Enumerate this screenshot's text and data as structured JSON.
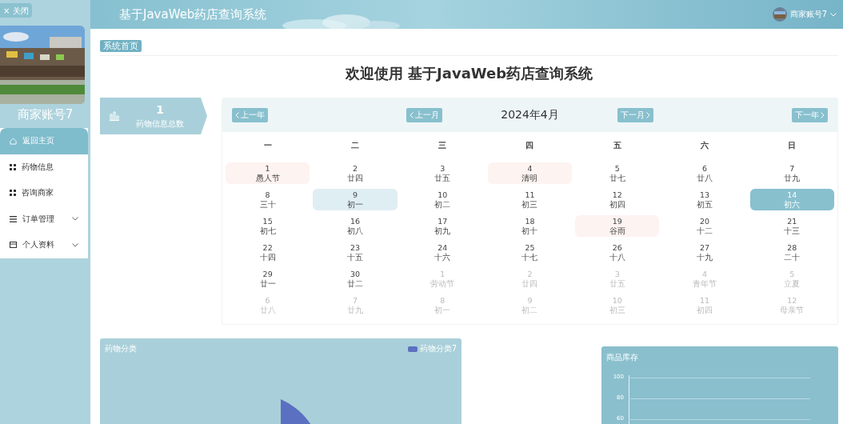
{
  "sidebar": {
    "close_button": "× 关闭",
    "user_name": "商家账号7",
    "menu": [
      {
        "label": "返回主页",
        "selected": true,
        "expandable": false
      },
      {
        "label": "药物信息",
        "selected": false,
        "expandable": false
      },
      {
        "label": "咨询商家",
        "selected": false,
        "expandable": false
      },
      {
        "label": "订单管理",
        "selected": false,
        "expandable": true
      },
      {
        "label": "个人资料",
        "selected": false,
        "expandable": true
      }
    ]
  },
  "header": {
    "title": "基于JavaWeb药店查询系统",
    "account": "商家账号7"
  },
  "breadcrumb": "系统首页",
  "welcome": "欢迎使用 基于JavaWeb药店查询系统",
  "stat_card": {
    "value": "1",
    "label": "药物信息总数"
  },
  "calendar": {
    "title": "2024年4月",
    "prev_year": "上一年",
    "prev_month": "上一月",
    "next_month": "下一月",
    "next_year": "下一年",
    "weekdays": [
      "一",
      "二",
      "三",
      "四",
      "五",
      "六",
      "日"
    ],
    "weeks": [
      [
        {
          "day": "1",
          "lunar": "愚人节",
          "kind": "festival"
        },
        {
          "day": "2",
          "lunar": "廿四",
          "kind": "day"
        },
        {
          "day": "3",
          "lunar": "廿五",
          "kind": "day"
        },
        {
          "day": "4",
          "lunar": "清明",
          "kind": "festival"
        },
        {
          "day": "5",
          "lunar": "廿七",
          "kind": "day"
        },
        {
          "day": "6",
          "lunar": "廿八",
          "kind": "day"
        },
        {
          "day": "7",
          "lunar": "廿九",
          "kind": "day"
        }
      ],
      [
        {
          "day": "8",
          "lunar": "三十",
          "kind": "day"
        },
        {
          "day": "9",
          "lunar": "初一",
          "kind": "hover"
        },
        {
          "day": "10",
          "lunar": "初二",
          "kind": "day"
        },
        {
          "day": "11",
          "lunar": "初三",
          "kind": "day"
        },
        {
          "day": "12",
          "lunar": "初四",
          "kind": "day"
        },
        {
          "day": "13",
          "lunar": "初五",
          "kind": "day"
        },
        {
          "day": "14",
          "lunar": "初六",
          "kind": "today"
        }
      ],
      [
        {
          "day": "15",
          "lunar": "初七",
          "kind": "day"
        },
        {
          "day": "16",
          "lunar": "初八",
          "kind": "day"
        },
        {
          "day": "17",
          "lunar": "初九",
          "kind": "day"
        },
        {
          "day": "18",
          "lunar": "初十",
          "kind": "day"
        },
        {
          "day": "19",
          "lunar": "谷雨",
          "kind": "festival"
        },
        {
          "day": "20",
          "lunar": "十二",
          "kind": "day"
        },
        {
          "day": "21",
          "lunar": "十三",
          "kind": "day"
        }
      ],
      [
        {
          "day": "22",
          "lunar": "十四",
          "kind": "day"
        },
        {
          "day": "23",
          "lunar": "十五",
          "kind": "day"
        },
        {
          "day": "24",
          "lunar": "十六",
          "kind": "day"
        },
        {
          "day": "25",
          "lunar": "十七",
          "kind": "day"
        },
        {
          "day": "26",
          "lunar": "十八",
          "kind": "day"
        },
        {
          "day": "27",
          "lunar": "十九",
          "kind": "day"
        },
        {
          "day": "28",
          "lunar": "二十",
          "kind": "day"
        }
      ],
      [
        {
          "day": "29",
          "lunar": "廿一",
          "kind": "day"
        },
        {
          "day": "30",
          "lunar": "廿二",
          "kind": "day"
        },
        {
          "day": "1",
          "lunar": "劳动节",
          "kind": "other"
        },
        {
          "day": "2",
          "lunar": "廿四",
          "kind": "other"
        },
        {
          "day": "3",
          "lunar": "廿五",
          "kind": "other"
        },
        {
          "day": "4",
          "lunar": "青年节",
          "kind": "other"
        },
        {
          "day": "5",
          "lunar": "立夏",
          "kind": "other"
        }
      ],
      [
        {
          "day": "6",
          "lunar": "廿八",
          "kind": "other"
        },
        {
          "day": "7",
          "lunar": "廿九",
          "kind": "other"
        },
        {
          "day": "8",
          "lunar": "初一",
          "kind": "other"
        },
        {
          "day": "9",
          "lunar": "初二",
          "kind": "other"
        },
        {
          "day": "10",
          "lunar": "初三",
          "kind": "other"
        },
        {
          "day": "11",
          "lunar": "初四",
          "kind": "other"
        },
        {
          "day": "12",
          "lunar": "母亲节",
          "kind": "other"
        }
      ]
    ]
  },
  "category_chart": {
    "title": "药物分类",
    "legend": [
      {
        "label": "药物分类7",
        "color": "#5b70c0"
      }
    ]
  },
  "stock_chart": {
    "title": "商品库存",
    "y_labels": [
      "100",
      "80",
      "60"
    ]
  }
}
